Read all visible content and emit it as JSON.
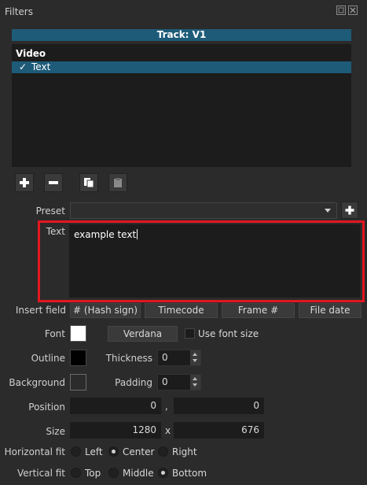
{
  "window": {
    "title": "Filters"
  },
  "track": {
    "header": "Track: V1"
  },
  "filter_list": {
    "group_label": "Video",
    "items": [
      {
        "label": "Text",
        "enabled_mark": "✓"
      }
    ]
  },
  "preset": {
    "label": "Preset",
    "value": ""
  },
  "text": {
    "label": "Text",
    "value": "example text"
  },
  "insert_field": {
    "label": "Insert field",
    "buttons": [
      "# (Hash sign)",
      "Timecode",
      "Frame #",
      "File date"
    ]
  },
  "font": {
    "label": "Font",
    "button": "Verdana",
    "use_font_size": "Use font size",
    "color": "#ffffff"
  },
  "outline": {
    "label": "Outline",
    "color": "#000000",
    "thickness_label": "Thickness",
    "thickness_value": "0"
  },
  "background": {
    "label": "Background",
    "padding_label": "Padding",
    "padding_value": "0"
  },
  "position": {
    "label": "Position",
    "x": "0",
    "sep": ",",
    "y": "0"
  },
  "size": {
    "label": "Size",
    "width": "1280",
    "sep": "x",
    "height": "676"
  },
  "horizontal_fit": {
    "label": "Horizontal fit",
    "options": [
      "Left",
      "Center",
      "Right"
    ],
    "selected": "Center"
  },
  "vertical_fit": {
    "label": "Vertical fit",
    "options": [
      "Top",
      "Middle",
      "Bottom"
    ],
    "selected": "Bottom"
  },
  "colors": {
    "accent": "#1e5b79",
    "highlight_box": "#e3171f",
    "panel": "#2b2b2b",
    "field": "#1c1c1c"
  }
}
